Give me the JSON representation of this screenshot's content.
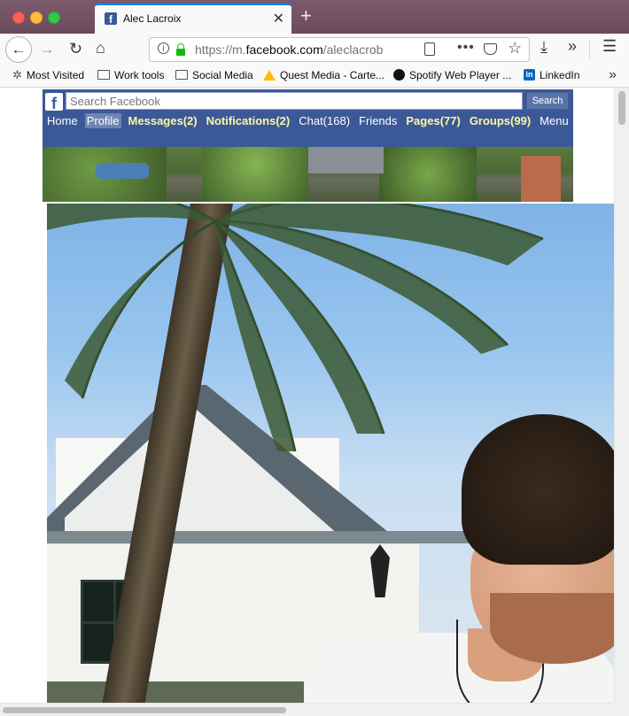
{
  "browser": {
    "tab_title": "Alec Lacroix",
    "tab_favicon": "facebook-icon",
    "new_tab": "+",
    "url_prefix": "https://m.",
    "url_host": "facebook.com",
    "url_path": "/aleclacrob",
    "icons": [
      "back-icon",
      "forward-icon",
      "reload-icon",
      "home-icon",
      "info-icon",
      "lock-icon",
      "reader-icon",
      "more-icon",
      "pocket-icon",
      "star-icon",
      "download-icon",
      "overflow-icon",
      "menu-icon"
    ]
  },
  "bookmarks": [
    {
      "label": "Most Visited",
      "icon": "gear-icon"
    },
    {
      "label": "Work tools",
      "icon": "folder-icon"
    },
    {
      "label": "Social Media",
      "icon": "folder-icon"
    },
    {
      "label": "Quest Media - Carte...",
      "icon": "google-drive-icon"
    },
    {
      "label": "Spotify Web Player ...",
      "icon": "spotify-icon"
    },
    {
      "label": "LinkedIn",
      "icon": "linkedin-icon"
    }
  ],
  "facebook": {
    "search_placeholder": "Search Facebook",
    "search_button": "Search",
    "nav": {
      "home": "Home",
      "profile": "Profile",
      "messages": "Messages(2)",
      "notifications": "Notifications(2)",
      "chat": "Chat(168)",
      "friends": "Friends",
      "pages": "Pages(77)",
      "groups": "Groups(99)",
      "menu": "Menu"
    },
    "active_nav": "Profile",
    "brand_color": "#3b5998",
    "highlight_color": "#fff7a3"
  }
}
